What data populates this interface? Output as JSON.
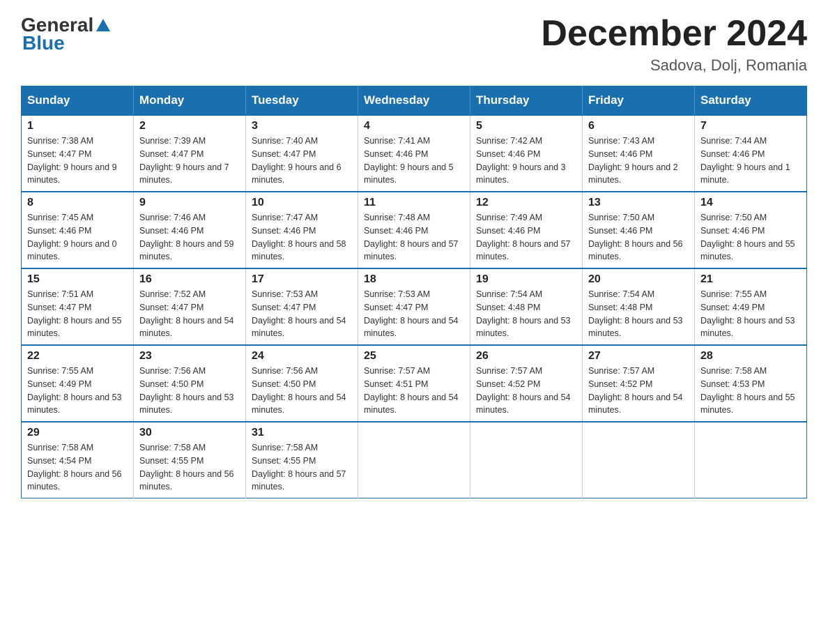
{
  "header": {
    "logo": {
      "general": "General",
      "blue": "Blue"
    },
    "title": "December 2024",
    "location": "Sadova, Dolj, Romania"
  },
  "weekdays": [
    "Sunday",
    "Monday",
    "Tuesday",
    "Wednesday",
    "Thursday",
    "Friday",
    "Saturday"
  ],
  "weeks": [
    [
      {
        "day": "1",
        "sunrise": "Sunrise: 7:38 AM",
        "sunset": "Sunset: 4:47 PM",
        "daylight": "Daylight: 9 hours and 9 minutes."
      },
      {
        "day": "2",
        "sunrise": "Sunrise: 7:39 AM",
        "sunset": "Sunset: 4:47 PM",
        "daylight": "Daylight: 9 hours and 7 minutes."
      },
      {
        "day": "3",
        "sunrise": "Sunrise: 7:40 AM",
        "sunset": "Sunset: 4:47 PM",
        "daylight": "Daylight: 9 hours and 6 minutes."
      },
      {
        "day": "4",
        "sunrise": "Sunrise: 7:41 AM",
        "sunset": "Sunset: 4:46 PM",
        "daylight": "Daylight: 9 hours and 5 minutes."
      },
      {
        "day": "5",
        "sunrise": "Sunrise: 7:42 AM",
        "sunset": "Sunset: 4:46 PM",
        "daylight": "Daylight: 9 hours and 3 minutes."
      },
      {
        "day": "6",
        "sunrise": "Sunrise: 7:43 AM",
        "sunset": "Sunset: 4:46 PM",
        "daylight": "Daylight: 9 hours and 2 minutes."
      },
      {
        "day": "7",
        "sunrise": "Sunrise: 7:44 AM",
        "sunset": "Sunset: 4:46 PM",
        "daylight": "Daylight: 9 hours and 1 minute."
      }
    ],
    [
      {
        "day": "8",
        "sunrise": "Sunrise: 7:45 AM",
        "sunset": "Sunset: 4:46 PM",
        "daylight": "Daylight: 9 hours and 0 minutes."
      },
      {
        "day": "9",
        "sunrise": "Sunrise: 7:46 AM",
        "sunset": "Sunset: 4:46 PM",
        "daylight": "Daylight: 8 hours and 59 minutes."
      },
      {
        "day": "10",
        "sunrise": "Sunrise: 7:47 AM",
        "sunset": "Sunset: 4:46 PM",
        "daylight": "Daylight: 8 hours and 58 minutes."
      },
      {
        "day": "11",
        "sunrise": "Sunrise: 7:48 AM",
        "sunset": "Sunset: 4:46 PM",
        "daylight": "Daylight: 8 hours and 57 minutes."
      },
      {
        "day": "12",
        "sunrise": "Sunrise: 7:49 AM",
        "sunset": "Sunset: 4:46 PM",
        "daylight": "Daylight: 8 hours and 57 minutes."
      },
      {
        "day": "13",
        "sunrise": "Sunrise: 7:50 AM",
        "sunset": "Sunset: 4:46 PM",
        "daylight": "Daylight: 8 hours and 56 minutes."
      },
      {
        "day": "14",
        "sunrise": "Sunrise: 7:50 AM",
        "sunset": "Sunset: 4:46 PM",
        "daylight": "Daylight: 8 hours and 55 minutes."
      }
    ],
    [
      {
        "day": "15",
        "sunrise": "Sunrise: 7:51 AM",
        "sunset": "Sunset: 4:47 PM",
        "daylight": "Daylight: 8 hours and 55 minutes."
      },
      {
        "day": "16",
        "sunrise": "Sunrise: 7:52 AM",
        "sunset": "Sunset: 4:47 PM",
        "daylight": "Daylight: 8 hours and 54 minutes."
      },
      {
        "day": "17",
        "sunrise": "Sunrise: 7:53 AM",
        "sunset": "Sunset: 4:47 PM",
        "daylight": "Daylight: 8 hours and 54 minutes."
      },
      {
        "day": "18",
        "sunrise": "Sunrise: 7:53 AM",
        "sunset": "Sunset: 4:47 PM",
        "daylight": "Daylight: 8 hours and 54 minutes."
      },
      {
        "day": "19",
        "sunrise": "Sunrise: 7:54 AM",
        "sunset": "Sunset: 4:48 PM",
        "daylight": "Daylight: 8 hours and 53 minutes."
      },
      {
        "day": "20",
        "sunrise": "Sunrise: 7:54 AM",
        "sunset": "Sunset: 4:48 PM",
        "daylight": "Daylight: 8 hours and 53 minutes."
      },
      {
        "day": "21",
        "sunrise": "Sunrise: 7:55 AM",
        "sunset": "Sunset: 4:49 PM",
        "daylight": "Daylight: 8 hours and 53 minutes."
      }
    ],
    [
      {
        "day": "22",
        "sunrise": "Sunrise: 7:55 AM",
        "sunset": "Sunset: 4:49 PM",
        "daylight": "Daylight: 8 hours and 53 minutes."
      },
      {
        "day": "23",
        "sunrise": "Sunrise: 7:56 AM",
        "sunset": "Sunset: 4:50 PM",
        "daylight": "Daylight: 8 hours and 53 minutes."
      },
      {
        "day": "24",
        "sunrise": "Sunrise: 7:56 AM",
        "sunset": "Sunset: 4:50 PM",
        "daylight": "Daylight: 8 hours and 54 minutes."
      },
      {
        "day": "25",
        "sunrise": "Sunrise: 7:57 AM",
        "sunset": "Sunset: 4:51 PM",
        "daylight": "Daylight: 8 hours and 54 minutes."
      },
      {
        "day": "26",
        "sunrise": "Sunrise: 7:57 AM",
        "sunset": "Sunset: 4:52 PM",
        "daylight": "Daylight: 8 hours and 54 minutes."
      },
      {
        "day": "27",
        "sunrise": "Sunrise: 7:57 AM",
        "sunset": "Sunset: 4:52 PM",
        "daylight": "Daylight: 8 hours and 54 minutes."
      },
      {
        "day": "28",
        "sunrise": "Sunrise: 7:58 AM",
        "sunset": "Sunset: 4:53 PM",
        "daylight": "Daylight: 8 hours and 55 minutes."
      }
    ],
    [
      {
        "day": "29",
        "sunrise": "Sunrise: 7:58 AM",
        "sunset": "Sunset: 4:54 PM",
        "daylight": "Daylight: 8 hours and 56 minutes."
      },
      {
        "day": "30",
        "sunrise": "Sunrise: 7:58 AM",
        "sunset": "Sunset: 4:55 PM",
        "daylight": "Daylight: 8 hours and 56 minutes."
      },
      {
        "day": "31",
        "sunrise": "Sunrise: 7:58 AM",
        "sunset": "Sunset: 4:55 PM",
        "daylight": "Daylight: 8 hours and 57 minutes."
      },
      null,
      null,
      null,
      null
    ]
  ]
}
